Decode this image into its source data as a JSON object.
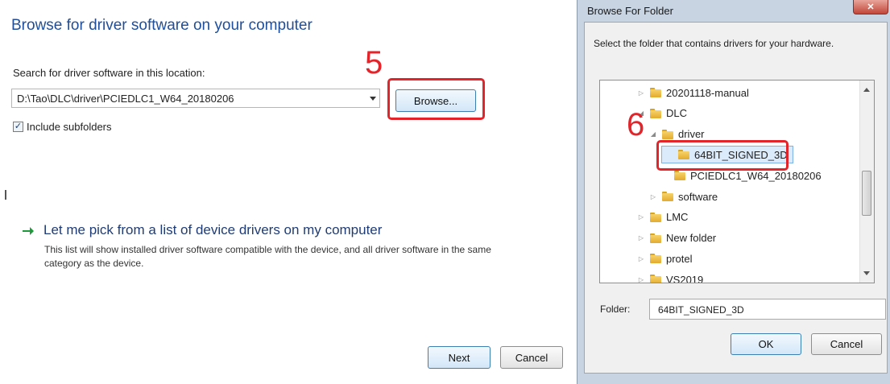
{
  "wizard": {
    "title": "Browse for driver software on your computer",
    "search_label": "Search for driver software in this location:",
    "path_value": "D:\\Tao\\DLC\\driver\\PCIEDLC1_W64_20180206",
    "browse_label": "Browse...",
    "include_subfolders_label": "Include subfolders",
    "include_subfolders_checked": true,
    "pick_title": "Let me pick from a list of device drivers on my computer",
    "pick_description": "This list will show installed driver software compatible with the device, and all driver software in the same category as the device.",
    "next_label": "Next",
    "cancel_label": "Cancel",
    "step_marker": "5"
  },
  "folder_dialog": {
    "title": "Browse For Folder",
    "close_icon": "close-icon",
    "instruction": "Select the folder that contains drivers for your hardware.",
    "tree": [
      {
        "label": "20201118-manual",
        "expander": "collapsed",
        "level": 0
      },
      {
        "label": "DLC",
        "expander": "expanded",
        "level": 0
      },
      {
        "label": "driver",
        "expander": "expanded",
        "level": 1
      },
      {
        "label": "64BIT_SIGNED_3D",
        "expander": "none",
        "level": 2,
        "selected": true
      },
      {
        "label": "PCIEDLC1_W64_20180206",
        "expander": "none",
        "level": 2
      },
      {
        "label": "software",
        "expander": "collapsed",
        "level": 1
      },
      {
        "label": "LMC",
        "expander": "collapsed",
        "level": 0
      },
      {
        "label": "New folder",
        "expander": "collapsed",
        "level": 0
      },
      {
        "label": "protel",
        "expander": "collapsed",
        "level": 0
      },
      {
        "label": "VS2019",
        "expander": "collapsed",
        "level": 0
      }
    ],
    "folder_label": "Folder:",
    "folder_value": "64BIT_SIGNED_3D",
    "ok_label": "OK",
    "cancel_label": "Cancel",
    "step_marker": "6"
  },
  "colors": {
    "title_blue": "#1f4e9a",
    "annotation_red": "#e1252b",
    "link_arrow_green": "#1f9a3a"
  }
}
